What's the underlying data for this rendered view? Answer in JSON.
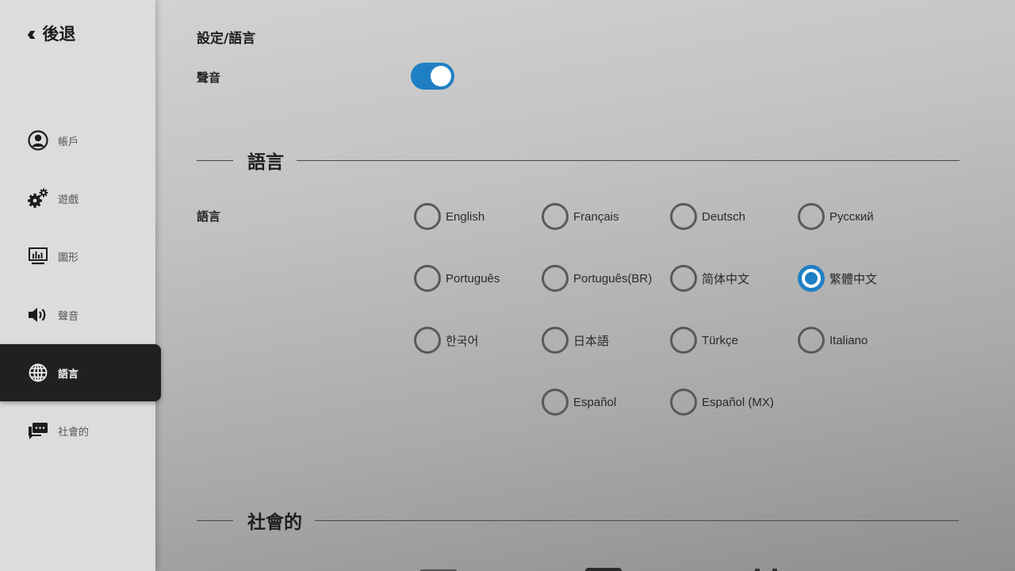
{
  "sidebar": {
    "back_label": "後退",
    "items": [
      {
        "label": "帳戶",
        "icon": "account-icon"
      },
      {
        "label": "遊戲",
        "icon": "gears-icon"
      },
      {
        "label": "圖形",
        "icon": "graphics-monitor-icon"
      },
      {
        "label": "聲音",
        "icon": "speaker-icon"
      },
      {
        "label": "語言",
        "icon": "globe-icon",
        "active": true
      },
      {
        "label": "社會的",
        "icon": "chat-icon"
      }
    ]
  },
  "main": {
    "breadcrumb": "設定/語言",
    "sound": {
      "label": "聲音",
      "enabled": true
    },
    "language_section": {
      "title": "語言",
      "row_label": "語言",
      "options": [
        "English",
        "Français",
        "Deutsch",
        "Русский",
        "Português",
        "Português(BR)",
        "简体中文",
        "繁體中文",
        "한국어",
        "日本語",
        "Türkçe",
        "Italiano",
        "Español",
        "Español (MX)"
      ],
      "selected": "繁體中文"
    },
    "social_section": {
      "title": "社會的"
    }
  },
  "colors": {
    "accent": "#1f7fc4",
    "sidebar_active_bg": "#202020",
    "sidebar_bg": "#dcdcdc"
  }
}
